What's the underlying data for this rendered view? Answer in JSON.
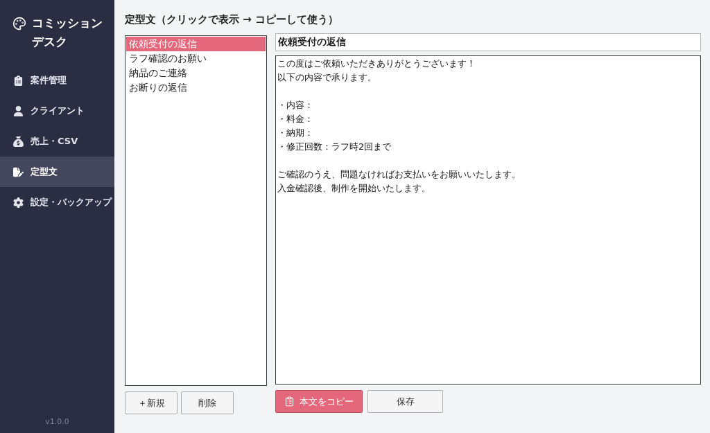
{
  "sidebar": {
    "app_title": "コミッションデスク",
    "nav": [
      {
        "label": "案件管理",
        "selected": false
      },
      {
        "label": "クライアント",
        "selected": false
      },
      {
        "label": "売上・CSV",
        "selected": false
      },
      {
        "label": "定型文",
        "selected": true
      },
      {
        "label": "設定・バックアップ",
        "selected": false
      }
    ],
    "version": "v1.0.0"
  },
  "heading": "定型文（クリックで表示 → コピーして使う）",
  "templates": {
    "items": [
      {
        "label": "依頼受付の返信",
        "selected": true
      },
      {
        "label": "ラフ確認のお願い",
        "selected": false
      },
      {
        "label": "納品のご連絡",
        "selected": false
      },
      {
        "label": "お断りの返信",
        "selected": false
      }
    ],
    "buttons": [
      "＋新規",
      "削除"
    ]
  },
  "editor": {
    "title": "依頼受付の返信",
    "body_paragraphs": [
      [
        "この度はご依頼いただきありがとうございます！",
        "以下の内容で承ります。"
      ],
      [
        "・内容：",
        "・料金：",
        "・納期：",
        "・修正回数：ラフ時2回まで"
      ],
      [
        "ご確認のうえ、問題なければお支払いをお願いいたします。",
        "入金確認後、制作を開始いたします。"
      ]
    ],
    "buttons": [
      {
        "label": "本文をコピー",
        "kind": "primary"
      },
      {
        "label": "保存",
        "kind": "secondary"
      }
    ]
  }
}
